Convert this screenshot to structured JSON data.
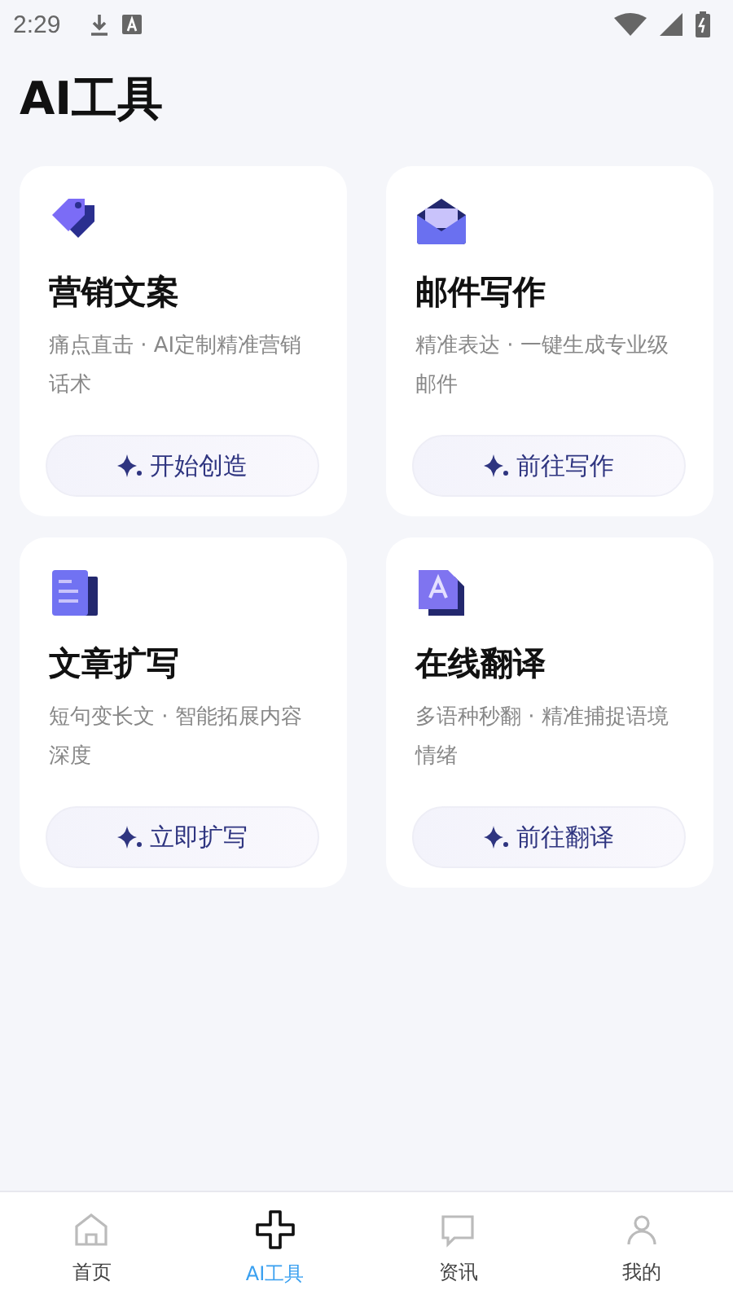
{
  "status_bar": {
    "time": "2:29"
  },
  "title": "AI工具",
  "cards": [
    {
      "kind": "tag",
      "title": "营销文案",
      "description": "痛点直击 · AI定制精准营销话术",
      "button": "开始创造"
    },
    {
      "kind": "mail",
      "title": "邮件写作",
      "description": "精准表达 · 一键生成专业级邮件",
      "button": "前往写作"
    },
    {
      "kind": "document",
      "title": "文章扩写",
      "description": "短句变长文 · 智能拓展内容深度",
      "button": "立即扩写"
    },
    {
      "kind": "translate",
      "title": "在线翻译",
      "description": "多语种秒翻 · 精准捕捉语境情绪",
      "button": "前往翻译"
    }
  ],
  "tab_bar": [
    {
      "kind": "home",
      "label": "首页",
      "selected": false
    },
    {
      "kind": "tools",
      "label": "AI工具",
      "selected": true
    },
    {
      "kind": "news",
      "label": "资讯",
      "selected": false
    },
    {
      "kind": "profile",
      "label": "我的",
      "selected": false
    }
  ]
}
